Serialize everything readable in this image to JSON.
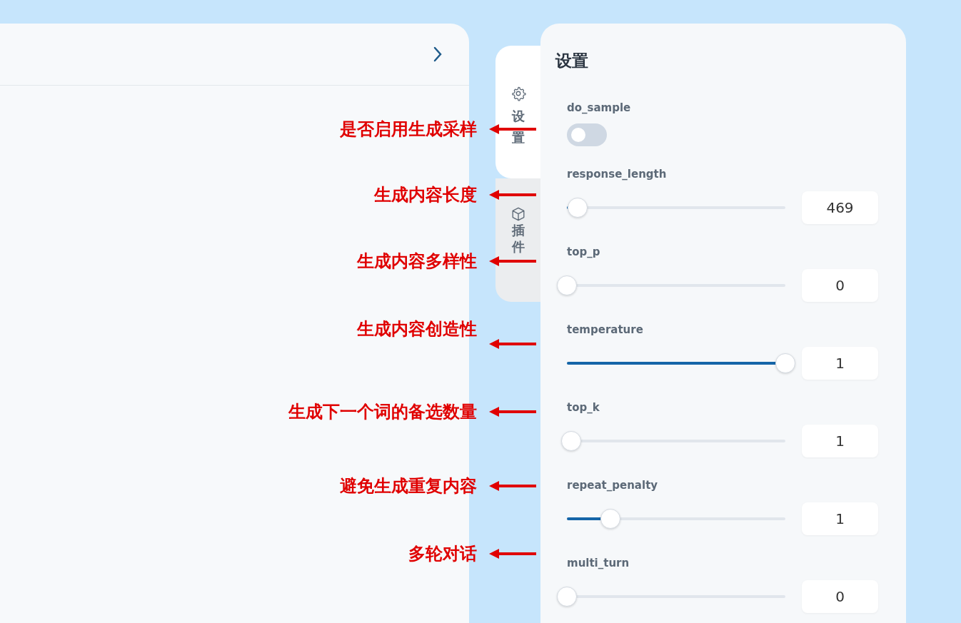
{
  "side_tabs": [
    {
      "label": "设置",
      "selected": true
    },
    {
      "label": "插件",
      "selected": false
    }
  ],
  "settings": {
    "title": "设置",
    "items": [
      {
        "kind": "toggle",
        "label": "do_sample",
        "on": false
      },
      {
        "kind": "slider",
        "label": "response_length",
        "level": 0.05,
        "value": "469"
      },
      {
        "kind": "slider",
        "label": "top_p",
        "level": 0,
        "value": "0"
      },
      {
        "kind": "slider",
        "label": "temperature",
        "level": 1,
        "value": "1"
      },
      {
        "kind": "slider",
        "label": "top_k",
        "level": 0.02,
        "value": "1"
      },
      {
        "kind": "slider",
        "label": "repeat_penalty",
        "level": 0.2,
        "value": "1"
      },
      {
        "kind": "slider",
        "label": "multi_turn",
        "level": 0,
        "value": "0"
      }
    ]
  },
  "annotations": [
    {
      "text": "是否启用生成采样"
    },
    {
      "text": "生成内容长度"
    },
    {
      "text": "生成内容多样性"
    },
    {
      "text": "生成内容创造性"
    },
    {
      "text": "生成下一个词的备选数量"
    },
    {
      "text": "避免生成重复内容"
    },
    {
      "text": "多轮对话"
    }
  ]
}
